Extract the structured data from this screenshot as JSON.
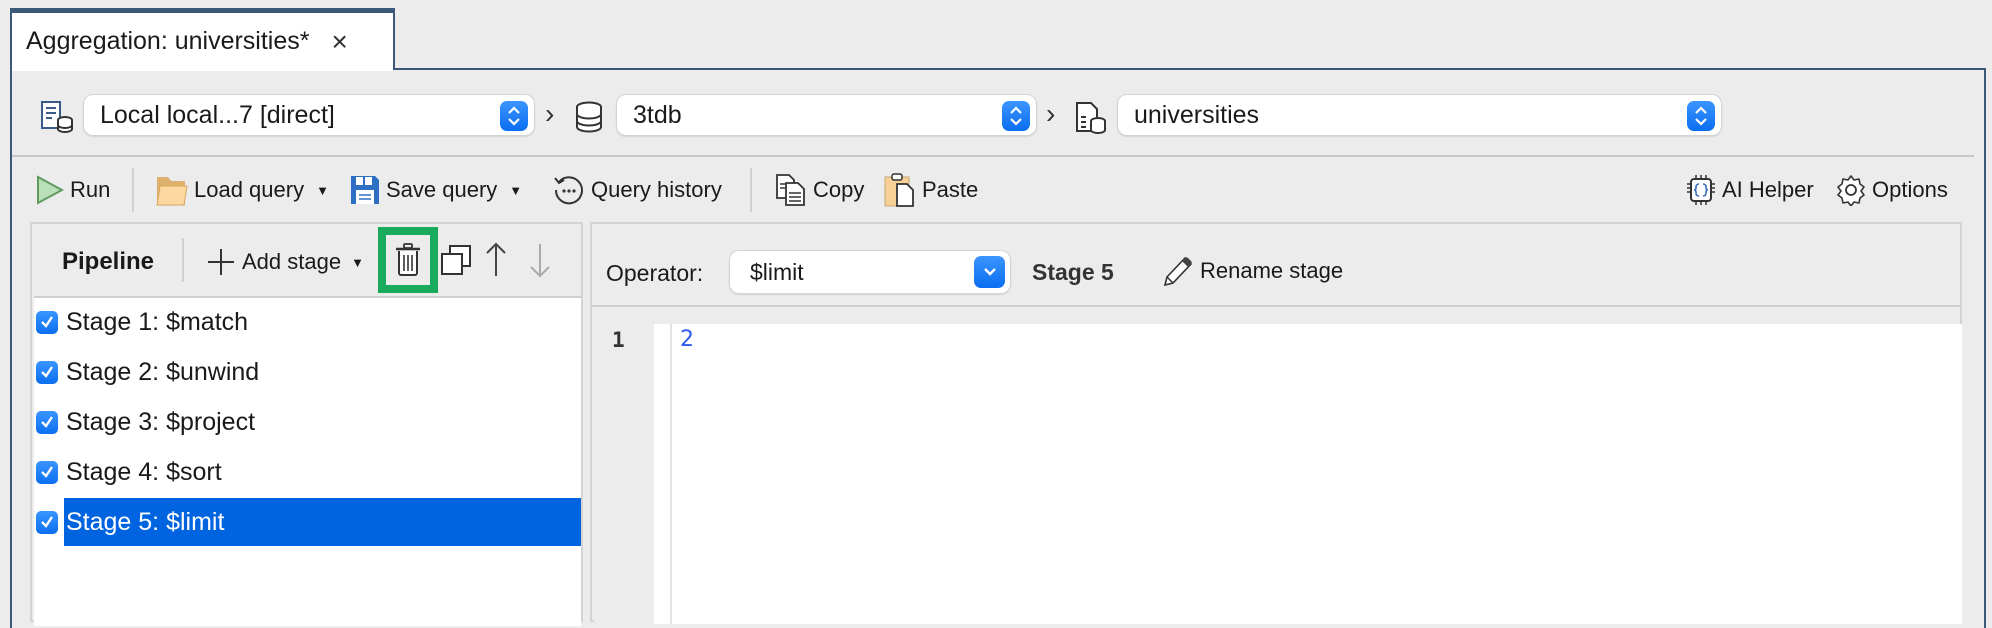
{
  "tab": {
    "title": "Aggregation: universities*",
    "close_icon": "×"
  },
  "connection": {
    "server": "Local local...7 [direct]",
    "database": "3tdb",
    "collection": "universities"
  },
  "toolbar": {
    "run": "Run",
    "load_query": "Load query",
    "save_query": "Save query",
    "query_history": "Query history",
    "copy": "Copy",
    "paste": "Paste",
    "ai_helper": "AI Helper",
    "options": "Options"
  },
  "pipeline": {
    "title": "Pipeline",
    "add_stage": "Add stage",
    "stages": [
      {
        "label": "Stage 1: $match",
        "checked": true
      },
      {
        "label": "Stage 2: $unwind",
        "checked": true
      },
      {
        "label": "Stage 3: $project",
        "checked": true
      },
      {
        "label": "Stage 4: $sort",
        "checked": true
      },
      {
        "label": "Stage 5: $limit",
        "checked": true,
        "selected": true
      }
    ],
    "highlight_color": "#1aab5e"
  },
  "stage_editor": {
    "operator_label": "Operator:",
    "operator_value": "$limit",
    "stage_name": "Stage 5",
    "rename": "Rename stage",
    "lines": [
      {
        "number": "1",
        "code": "2"
      }
    ]
  },
  "colors": {
    "accent": "#0a6ef0",
    "selection": "#0064e0",
    "frame": "#3a5878",
    "code_number": "#2e5cf0"
  }
}
